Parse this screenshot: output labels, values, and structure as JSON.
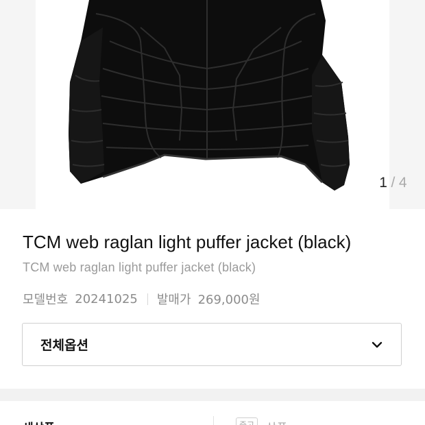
{
  "gallery": {
    "current_index": "1",
    "separator": "/",
    "total": "4",
    "image_icon": "black-puffer-jacket-photo"
  },
  "product": {
    "title": "TCM web raglan light puffer jacket (black)",
    "subtitle": "TCM web raglan light puffer jacket (black)",
    "model_label": "모델번호",
    "model_value": "20241025",
    "release_price_label": "발매가",
    "release_price_value": "269,000원"
  },
  "options": {
    "label": "전체옵션",
    "icon": "chevron-down-icon"
  },
  "condition": {
    "left_label": "새상품",
    "badge": "중고",
    "right_label": "상품"
  },
  "colors": {
    "jacket": "#0d0d0d",
    "seam": "#2c2c2c",
    "muted_text": "#9a9a9a",
    "border": "#cfcfcf"
  }
}
